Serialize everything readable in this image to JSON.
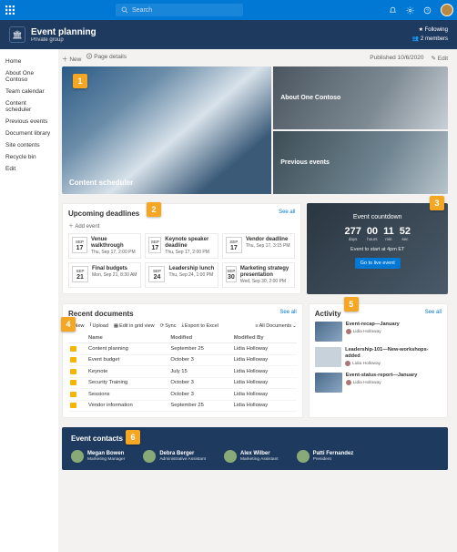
{
  "suite": {
    "search_placeholder": "Search",
    "icons": [
      "bell",
      "settings",
      "help"
    ]
  },
  "site": {
    "name": "Event planning",
    "type": "Private group",
    "following": "Following",
    "members": "2 members"
  },
  "nav": [
    "Home",
    "About One Contoso",
    "Team calendar",
    "Content scheduler",
    "Previous events",
    "Document library",
    "Site contents",
    "Recycle bin",
    "Edit"
  ],
  "page_cmd": {
    "new": "New",
    "details": "Page details",
    "published": "Published 10/6/2020",
    "edit": "Edit"
  },
  "hero": {
    "main": "Content scheduler",
    "tile1": "About One Contoso",
    "tile2": "Previous events"
  },
  "deadlines": {
    "title": "Upcoming deadlines",
    "add": "Add event",
    "seeall": "See all",
    "events": [
      {
        "mon": "SEP",
        "day": "17",
        "title": "Venue walkthrough",
        "sub": "Thu, Sep 17, 2:00 PM"
      },
      {
        "mon": "SEP",
        "day": "17",
        "title": "Keynote speaker deadline",
        "sub": "Thu, Sep 17, 2:00 PM"
      },
      {
        "mon": "SEP",
        "day": "17",
        "title": "Vendor deadline",
        "sub": "Thu, Sep 17, 3:15 PM"
      },
      {
        "mon": "SEP",
        "day": "21",
        "title": "Final budgets",
        "sub": "Mon, Sep 21, 8:30 AM"
      },
      {
        "mon": "SEP",
        "day": "24",
        "title": "Leadership lunch",
        "sub": "Thu, Sep 24, 1:00 PM"
      },
      {
        "mon": "SEP",
        "day": "30",
        "title": "Marketing strategy presentation",
        "sub": "Wed, Sep 30, 2:00 PM"
      }
    ]
  },
  "countdown": {
    "title": "Event countdown",
    "parts": [
      {
        "n": "277",
        "l": "days"
      },
      {
        "n": "00",
        "l": "hours"
      },
      {
        "n": "11",
        "l": "min"
      },
      {
        "n": "52",
        "l": "sec"
      }
    ],
    "note": "Event to start at 4pm ET",
    "cta": "Go to live event"
  },
  "docs": {
    "title": "Recent documents",
    "seeall": "See all",
    "cmds": {
      "new": "New",
      "upload": "Upload",
      "grid": "Edit in grid view",
      "sync": "Sync",
      "export": "Export to Excel",
      "all": "All Documents"
    },
    "cols": [
      "Name",
      "Modified",
      "Modified By"
    ],
    "rows": [
      [
        "Content planning",
        "September 25",
        "Lidia Holloway"
      ],
      [
        "Event budget",
        "October 3",
        "Lidia Holloway"
      ],
      [
        "Keynote",
        "July 15",
        "Lidia Holloway"
      ],
      [
        "Security Training",
        "October 3",
        "Lidia Holloway"
      ],
      [
        "Sessions",
        "October 3",
        "Lidia Holloway"
      ],
      [
        "Vendor information",
        "September 25",
        "Lidia Holloway"
      ]
    ]
  },
  "activity": {
    "title": "Activity",
    "seeall": "See all",
    "items": [
      {
        "title": "Event-recap—January",
        "by": "Lidia Holloway"
      },
      {
        "title": "Leadership-101—New-workshops-added",
        "by": "Lidia Holloway"
      },
      {
        "title": "Event-status-report—January",
        "by": "Lidia Holloway"
      }
    ]
  },
  "contacts": {
    "title": "Event contacts",
    "people": [
      {
        "name": "Megan Bowen",
        "role": "Marketing Manager"
      },
      {
        "name": "Debra Berger",
        "role": "Administrative Assistant"
      },
      {
        "name": "Alex Wilber",
        "role": "Marketing Assistant"
      },
      {
        "name": "Patti Fernandez",
        "role": "President"
      }
    ]
  },
  "ann": [
    "1",
    "2",
    "3",
    "4",
    "5",
    "6"
  ]
}
